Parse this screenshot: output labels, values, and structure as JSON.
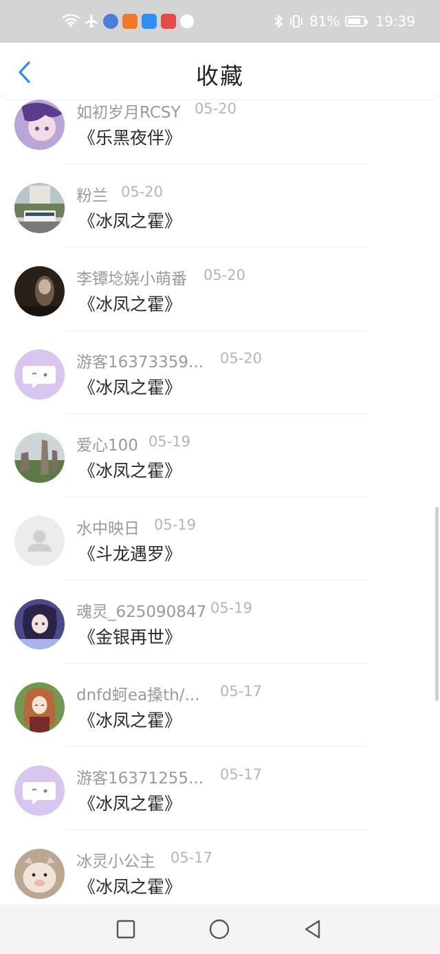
{
  "status_bar": {
    "battery_percent": "81%",
    "battery_level": 0.81,
    "time": "19:39",
    "icons": [
      "wifi-icon",
      "airplane-icon",
      "music-app-icon",
      "video-app-icon",
      "search-app-icon",
      "shop-app-icon",
      "ball-app-icon",
      "bluetooth-icon",
      "vibrate-icon",
      "battery-icon"
    ],
    "app_colors": [
      "#4a7fd6",
      "#f07a2a",
      "#2f8ff0",
      "#e64a4a"
    ]
  },
  "header": {
    "title": "收藏",
    "back_icon": "chevron-left-icon",
    "accent_color": "#2a8cf0"
  },
  "items": [
    {
      "name": "如初岁月RCSY",
      "date": "05-20",
      "book": "《乐黑夜伴》",
      "avatar": "anime-girl-purple"
    },
    {
      "name": "粉兰",
      "date": "05-20",
      "book": "《冰凤之霍》",
      "avatar": "photo-bus-street"
    },
    {
      "name": "李镡埝娆小萌番",
      "date": "05-20",
      "book": "《冰凤之霍》",
      "avatar": "photo-dark-portrait"
    },
    {
      "name": "游客16373359...",
      "date": "05-20",
      "book": "《冰凤之霍》",
      "avatar": "chat-bubble-icon"
    },
    {
      "name": "爱心100",
      "date": "05-19",
      "book": "《冰凤之霍》",
      "avatar": "photo-stone-forest"
    },
    {
      "name": "水中映日",
      "date": "05-19",
      "book": "《斗龙遇罗》",
      "avatar": "default-user-icon"
    },
    {
      "name": "魂灵_625090847",
      "date": "05-19",
      "book": "《金银再世》",
      "avatar": "anime-girl-dark"
    },
    {
      "name": "dnfd蚵ea搡th/...",
      "date": "05-17",
      "book": "《冰凤之霍》",
      "avatar": "anime-girl-green"
    },
    {
      "name": "游客16371255...",
      "date": "05-17",
      "book": "《冰凤之霍》",
      "avatar": "chat-bubble-icon"
    },
    {
      "name": "冰灵小公主",
      "date": "05-17",
      "book": "《冰凤之霍》",
      "avatar": "photo-cute-pig"
    }
  ],
  "nav_bar": {
    "icons": [
      "square-icon",
      "circle-icon",
      "triangle-back-icon"
    ]
  }
}
